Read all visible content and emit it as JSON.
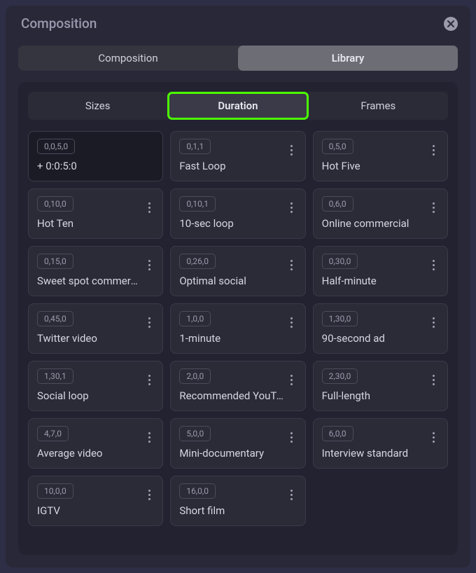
{
  "header": {
    "title": "Composition"
  },
  "mainTabs": {
    "composition": "Composition",
    "library": "Library",
    "activeIndex": 1
  },
  "subTabs": {
    "sizes": "Sizes",
    "duration": "Duration",
    "frames": "Frames",
    "activeIndex": 1
  },
  "cards": [
    {
      "tag": "0,0,5,0",
      "label": "+ 0:0:5:0",
      "dark": true,
      "menu": false
    },
    {
      "tag": "0,1,1",
      "label": "Fast Loop",
      "dark": false,
      "menu": true
    },
    {
      "tag": "0,5,0",
      "label": "Hot Five",
      "dark": false,
      "menu": true
    },
    {
      "tag": "0,10,0",
      "label": "Hot Ten",
      "dark": false,
      "menu": true
    },
    {
      "tag": "0,10,1",
      "label": "10-sec loop",
      "dark": false,
      "menu": true
    },
    {
      "tag": "0,6,0",
      "label": "Online commercial",
      "dark": false,
      "menu": true
    },
    {
      "tag": "0,15,0",
      "label": "Sweet spot commercial",
      "dark": false,
      "menu": true
    },
    {
      "tag": "0,26,0",
      "label": "Optimal social",
      "dark": false,
      "menu": true
    },
    {
      "tag": "0,30,0",
      "label": "Half-minute",
      "dark": false,
      "menu": true
    },
    {
      "tag": "0,45,0",
      "label": "Twitter video",
      "dark": false,
      "menu": true
    },
    {
      "tag": "1,0,0",
      "label": "1-minute",
      "dark": false,
      "menu": true
    },
    {
      "tag": "1,30,0",
      "label": "90-second ad",
      "dark": false,
      "menu": true
    },
    {
      "tag": "1,30,1",
      "label": "Social loop",
      "dark": false,
      "menu": true
    },
    {
      "tag": "2,0,0",
      "label": "Recommended YouTube",
      "dark": false,
      "menu": true
    },
    {
      "tag": "2,30,0",
      "label": "Full-length",
      "dark": false,
      "menu": true
    },
    {
      "tag": "4,7,0",
      "label": "Average video",
      "dark": false,
      "menu": true
    },
    {
      "tag": "5,0,0",
      "label": "Mini-documentary",
      "dark": false,
      "menu": true
    },
    {
      "tag": "6,0,0",
      "label": "Interview standard",
      "dark": false,
      "menu": true
    },
    {
      "tag": "10,0,0",
      "label": "IGTV",
      "dark": false,
      "menu": true
    },
    {
      "tag": "16,0,0",
      "label": "Short film",
      "dark": false,
      "menu": true
    }
  ]
}
